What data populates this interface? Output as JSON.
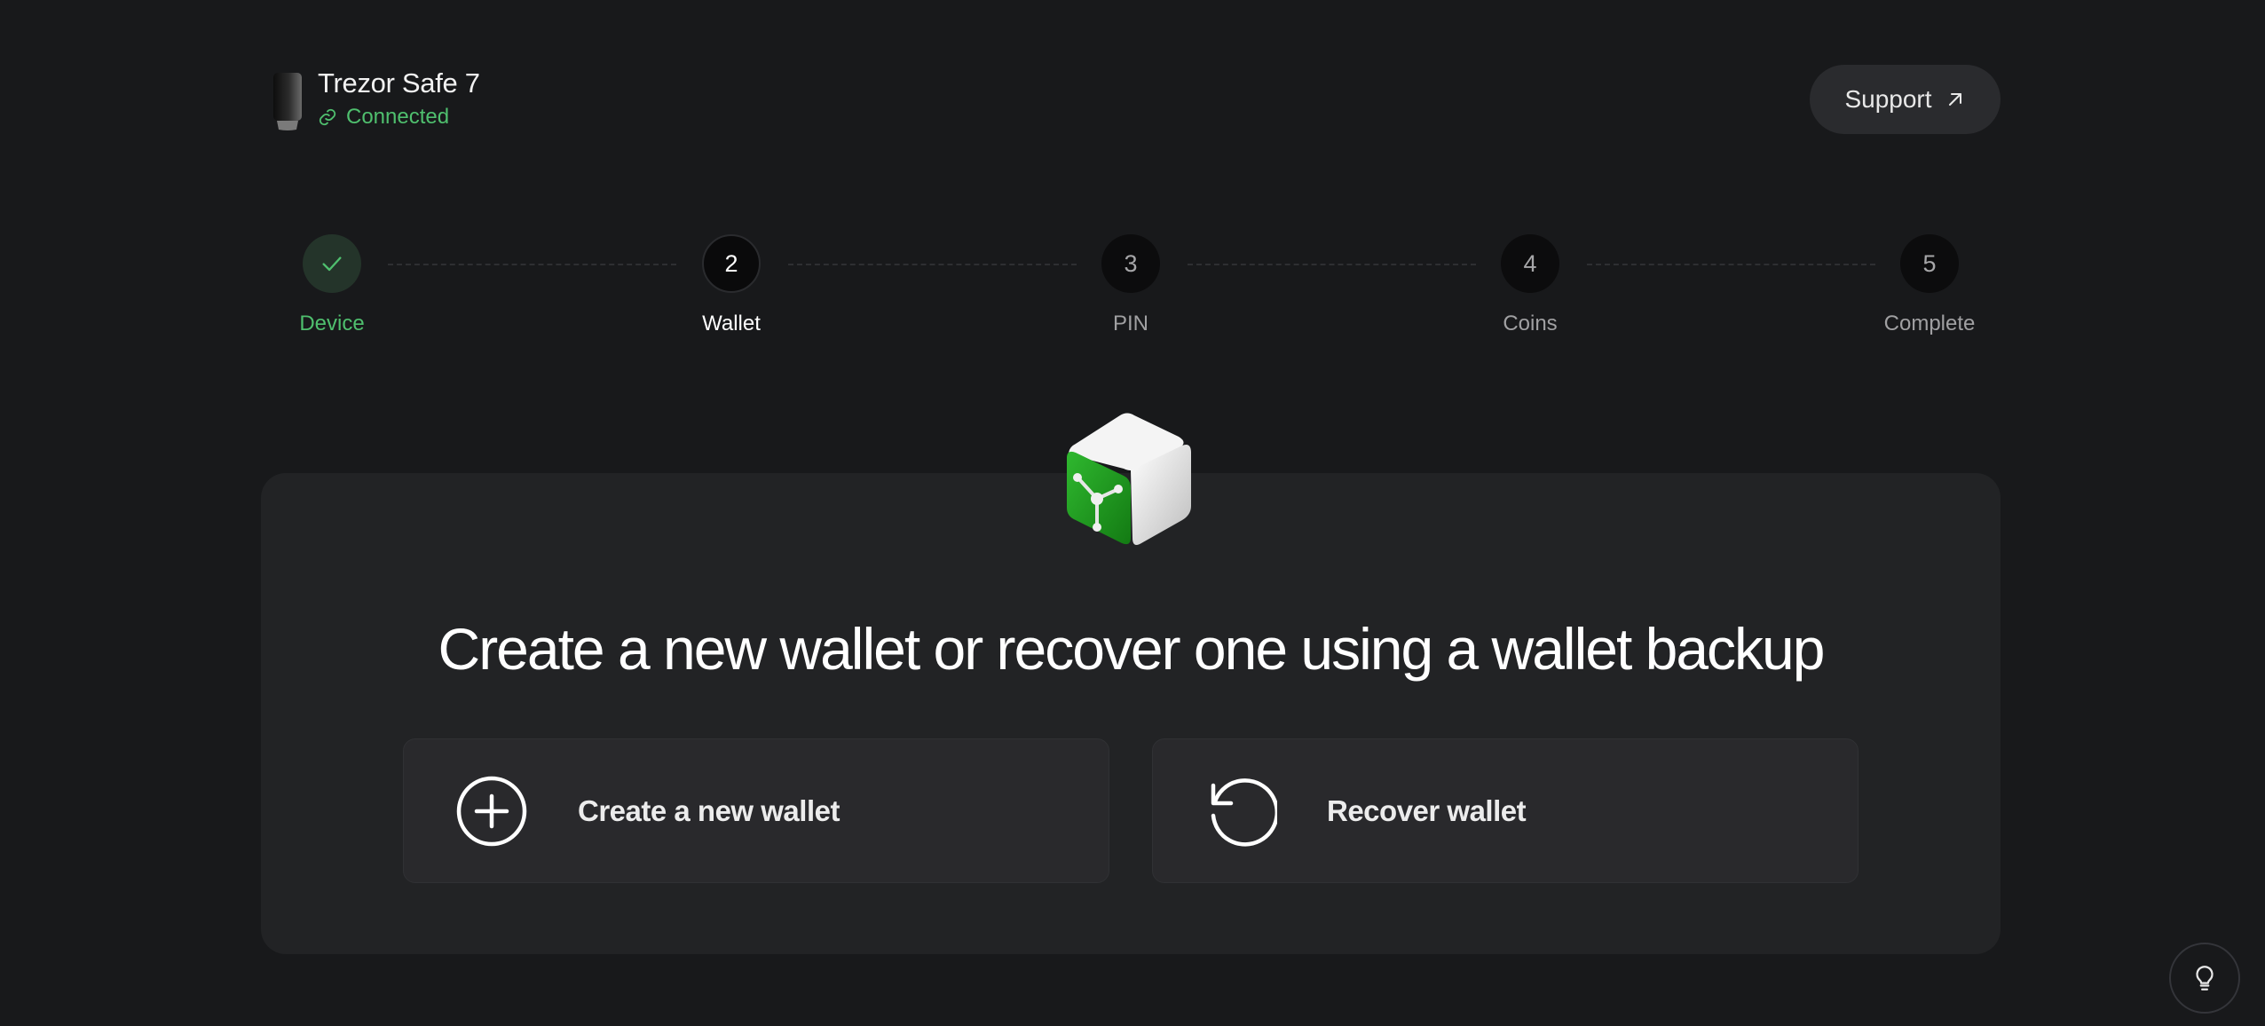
{
  "header": {
    "device_name": "Trezor Safe 7",
    "device_status": "Connected",
    "support_label": "Support"
  },
  "stepper": {
    "steps": [
      {
        "number": "",
        "label": "Device",
        "state": "done"
      },
      {
        "number": "2",
        "label": "Wallet",
        "state": "active"
      },
      {
        "number": "3",
        "label": "PIN",
        "state": "pending"
      },
      {
        "number": "4",
        "label": "Coins",
        "state": "pending"
      },
      {
        "number": "5",
        "label": "Complete",
        "state": "pending"
      }
    ]
  },
  "main": {
    "headline": "Create a new wallet or recover one using a wallet backup",
    "options": [
      {
        "label": "Create a new wallet",
        "icon": "plus-circle-icon"
      },
      {
        "label": "Recover wallet",
        "icon": "rotate-ccw-icon"
      }
    ]
  },
  "icons": {
    "device": "trezor-device-icon",
    "status": "link-icon",
    "support": "arrow-up-right-icon",
    "tips": "lightbulb-icon",
    "illustration": "safe-illustration"
  },
  "colors": {
    "background": "#18191b",
    "card": "#222325",
    "accent_green": "#4fbf6e",
    "safe_green": "#1e9a1e"
  }
}
